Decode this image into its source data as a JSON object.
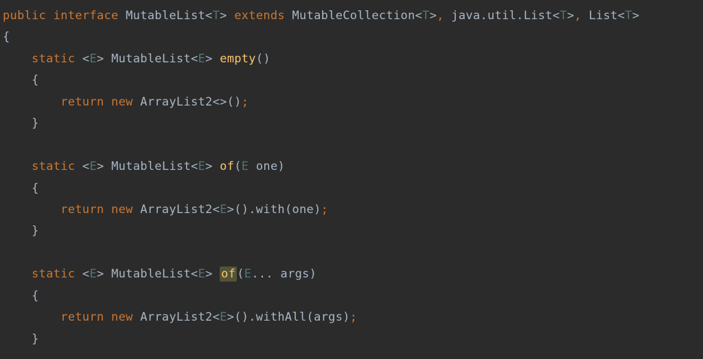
{
  "code": {
    "line1": {
      "public": "public",
      "interface": "interface",
      "class_name": "MutableList",
      "type_param_T": "T",
      "extends": "extends",
      "super1": "MutableCollection",
      "super2_pkg": "java.util.List",
      "super3": "List"
    },
    "line2": {
      "brace": "{"
    },
    "line3": {
      "static": "static",
      "lt": "<",
      "type_E": "E",
      "gt": ">",
      "return_type": "MutableList",
      "method": "empty",
      "parens": "()"
    },
    "line4": {
      "brace": "{"
    },
    "line5": {
      "return": "return",
      "new": "new",
      "class": "ArrayList2",
      "diamond": "<>",
      "call": "();"
    },
    "line6": {
      "brace": "}"
    },
    "line7": {
      "static": "static",
      "type_E": "E",
      "return_type": "MutableList",
      "method": "of",
      "param_type": "E",
      "param_name": "one"
    },
    "line8": {
      "brace": "{"
    },
    "line9": {
      "return": "return",
      "new": "new",
      "class": "ArrayList2",
      "type_E": "E",
      "method": "with",
      "arg": "one"
    },
    "line10": {
      "brace": "}"
    },
    "line11": {
      "static": "static",
      "type_E": "E",
      "return_type": "MutableList",
      "method": "of",
      "param_type": "E",
      "varargs": "...",
      "param_name": "args"
    },
    "line12": {
      "brace": "{"
    },
    "line13": {
      "return": "return",
      "new": "new",
      "class": "ArrayList2",
      "type_E": "E",
      "method": "withAll",
      "arg": "args"
    },
    "line14": {
      "brace": "}"
    }
  }
}
